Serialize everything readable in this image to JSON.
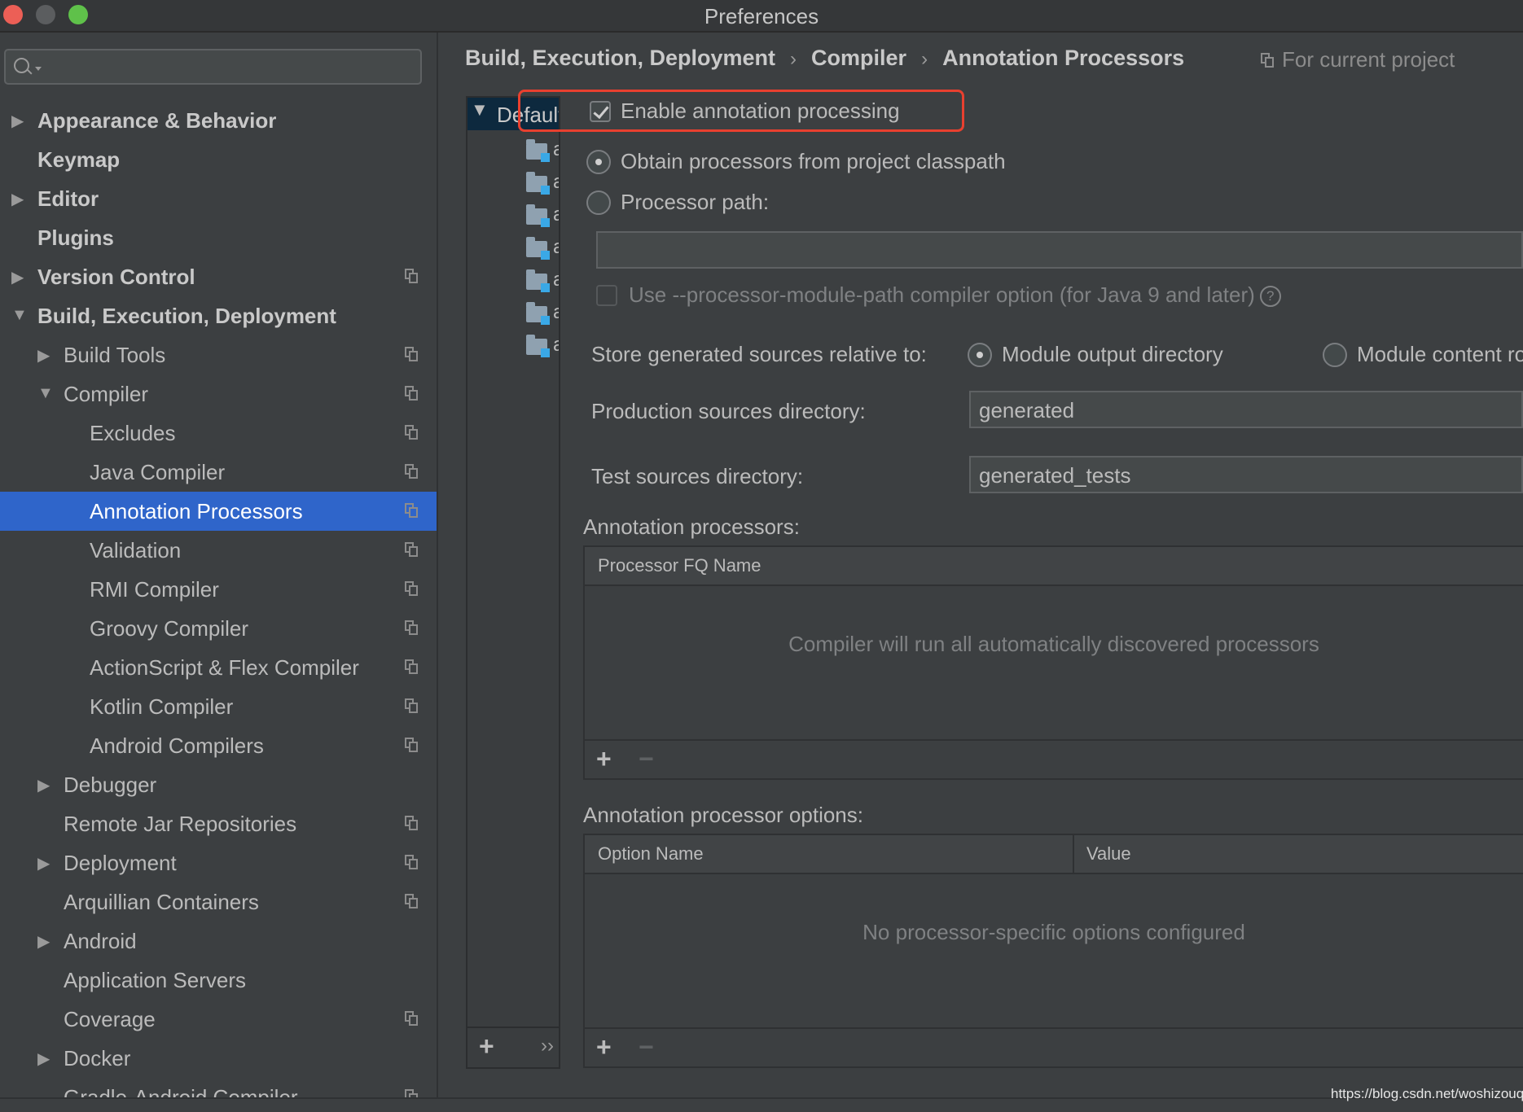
{
  "window": {
    "title": "Preferences"
  },
  "search": {
    "placeholder": ""
  },
  "sidebar": {
    "items": [
      {
        "label": "Appearance & Behavior",
        "arrow": "▶"
      },
      {
        "label": "Keymap"
      },
      {
        "label": "Editor",
        "arrow": "▶"
      },
      {
        "label": "Plugins"
      },
      {
        "label": "Version Control",
        "arrow": "▶"
      },
      {
        "label": "Build, Execution, Deployment",
        "arrow": "▼"
      },
      {
        "label": "Build Tools",
        "arrow": "▶"
      },
      {
        "label": "Compiler",
        "arrow": "▼"
      },
      {
        "label": "Excludes"
      },
      {
        "label": "Java Compiler"
      },
      {
        "label": "Annotation Processors"
      },
      {
        "label": "Validation"
      },
      {
        "label": "RMI Compiler"
      },
      {
        "label": "Groovy Compiler"
      },
      {
        "label": "ActionScript & Flex Compiler"
      },
      {
        "label": "Kotlin Compiler"
      },
      {
        "label": "Android Compilers"
      },
      {
        "label": "Debugger",
        "arrow": "▶"
      },
      {
        "label": "Remote Jar Repositories"
      },
      {
        "label": "Deployment",
        "arrow": "▶"
      },
      {
        "label": "Arquillian Containers"
      },
      {
        "label": "Android",
        "arrow": "▶"
      },
      {
        "label": "Application Servers"
      },
      {
        "label": "Coverage"
      },
      {
        "label": "Docker",
        "arrow": "▶"
      },
      {
        "label": "Gradle-Android Compiler"
      }
    ]
  },
  "breadcrumb": {
    "part1": "Build, Execution, Deployment",
    "part2": "Compiler",
    "part3": "Annotation Processors",
    "separator": "›"
  },
  "scope": {
    "label": "For current project"
  },
  "profiles": {
    "selected": "Default",
    "module_char": "a",
    "more": "››",
    "add": "+"
  },
  "settings": {
    "enable_label": "Enable annotation processing",
    "obtain_label": "Obtain processors from project classpath",
    "path_label": "Processor path:",
    "path_value": "",
    "module_path_label": "Use --processor-module-path compiler option (for Java 9 and later)",
    "help": "?",
    "store_label": "Store generated sources relative to:",
    "store_option1": "Module output directory",
    "store_option2": "Module content root",
    "prod_label": "Production sources directory:",
    "prod_value": "generated",
    "test_label": "Test sources directory:",
    "test_value": "generated_tests"
  },
  "processors": {
    "title": "Annotation processors:",
    "col": "Processor FQ Name",
    "empty": "Compiler will run all automatically discovered processors",
    "add": "+",
    "remove": "−"
  },
  "options": {
    "title": "Annotation processor options:",
    "col1": "Option Name",
    "col2": "Value",
    "empty": "No processor-specific options configured",
    "add": "+",
    "remove": "−"
  },
  "watermark": "https://blog.csdn.net/woshizouqi",
  "colors": {
    "selection": "#2f65ca",
    "highlight": "#e8402f",
    "background": "#3c3f41"
  }
}
